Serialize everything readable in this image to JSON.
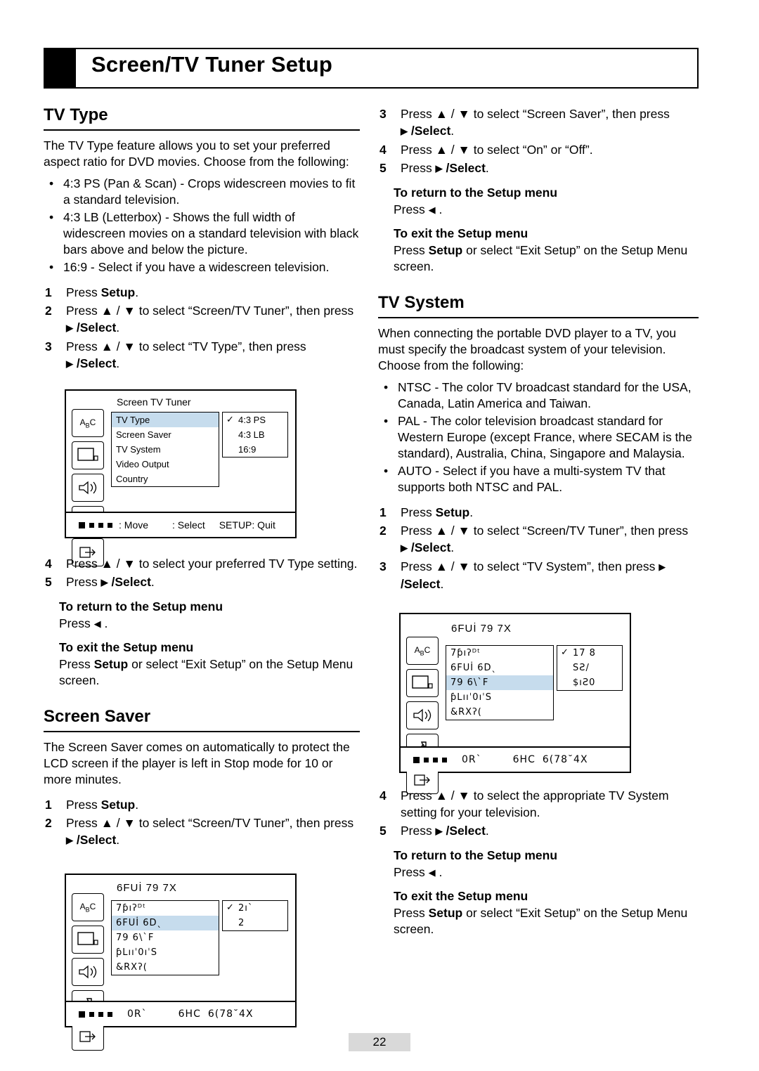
{
  "header": {
    "title": "Screen/TV Tuner Setup"
  },
  "page_number": "22",
  "left": {
    "tv_type": {
      "heading": "TV Type",
      "intro": "The TV Type feature allows you to set your preferred aspect ratio for DVD movies. Choose from the following:",
      "bullets": [
        "4:3 PS (Pan & Scan) - Crops widescreen movies to fit a standard television.",
        "4:3 LB (Letterbox) - Shows the full width of widescreen movies on a standard television with black bars above and below the picture.",
        "16:9 - Select if you have a widescreen television."
      ],
      "steps": [
        {
          "n": "1",
          "text": "Press Setup."
        },
        {
          "n": "2",
          "text": "Press ▲ / ▼ to select “Screen/TV Tuner”, then press ▶ /Select."
        },
        {
          "n": "3",
          "text": "Press ▲ / ▼ to select “TV Type”, then press ▶ /Select."
        }
      ],
      "steps2": [
        {
          "n": "4",
          "text": "Press ▲ / ▼ to select your preferred TV Type setting."
        },
        {
          "n": "5",
          "text": "Press ▶ /Select."
        }
      ],
      "return_head": "To return to the Setup menu",
      "return_body": "Press ◀ .",
      "exit_head": "To exit the Setup menu",
      "exit_body": "Press Setup or select “Exit Setup” on the Setup Menu screen."
    },
    "screen_saver": {
      "heading": "Screen Saver",
      "intro": "The Screen Saver comes on automatically to protect the LCD screen if the player is left in Stop mode for 10 or more minutes.",
      "steps": [
        {
          "n": "1",
          "text": "Press Setup."
        },
        {
          "n": "2",
          "text": "Press ▲ / ▼ to select “Screen/TV Tuner”, then press ▶ /Select."
        }
      ]
    },
    "osd_tvtype": {
      "title": "Screen TV Tuner",
      "menu": [
        "TV Type",
        "Screen Saver",
        "TV System",
        "Video Output",
        "Country"
      ],
      "highlight_index": 0,
      "options": [
        "4:3 PS",
        "4:3 LB",
        "16:9"
      ],
      "checked_index": 0,
      "footer": [
        ": Move",
        ": Select",
        "SETUP: Quit"
      ]
    },
    "osd_screensaver": {
      "title": "6FUİ 79 7X",
      "menu": [
        "7ƥıʔᴰᵗ",
        "6FUİ 6Dˎ",
        "79 6\\ˋF",
        "ƥLııˈ0ıˈS",
        "&RXʔ("
      ],
      "highlight_index": 1,
      "options": [
        "2ıˋ",
        "2"
      ],
      "checked_index": 0,
      "footer": [
        "0Rˋ",
        "6HC",
        "6(78˘4X"
      ]
    }
  },
  "right": {
    "tv_type_cont": {
      "steps": [
        {
          "n": "3",
          "text": "Press ▲ / ▼ to select “Screen Saver”, then press ▶ /Select."
        },
        {
          "n": "4",
          "text": "Press ▲ / ▼ to select “On” or “Off”."
        },
        {
          "n": "5",
          "text": "Press ▶ /Select."
        }
      ],
      "return_head": "To return to the Setup menu",
      "return_body": "Press ◀ .",
      "exit_head": "To exit the Setup menu",
      "exit_body": "Press Setup or select “Exit Setup” on the Setup Menu screen."
    },
    "tv_system": {
      "heading": "TV System",
      "intro": "When connecting the portable DVD player to a TV, you must specify the broadcast system of your television. Choose from the following:",
      "bullets": [
        "NTSC - The color TV broadcast standard for the USA, Canada, Latin America and Taiwan.",
        "PAL - The color television broadcast standard for Western Europe (except France, where SECAM is the standard), Australia, China, Singapore and Malaysia.",
        "AUTO - Select if you have a multi-system TV that supports both NTSC and PAL."
      ],
      "steps": [
        {
          "n": "1",
          "text": "Press Setup."
        },
        {
          "n": "2",
          "text": "Press ▲ / ▼ to select “Screen/TV Tuner”, then press ▶ /Select."
        },
        {
          "n": "3",
          "text": "Press ▲ / ▼ to select “TV System”, then press ▶ /Select."
        }
      ],
      "steps2": [
        {
          "n": "4",
          "text": "Press ▲ / ▼ to select the appropriate TV System setting for your television."
        },
        {
          "n": "5",
          "text": "Press ▶ /Select."
        }
      ],
      "return_head": "To return to the Setup menu",
      "return_body": "Press ◀ .",
      "exit_head": "To exit the Setup menu",
      "exit_body": "Press Setup or select “Exit Setup” on the Setup Menu screen."
    },
    "osd_tvsystem": {
      "title": "6FUİ 79 7X",
      "menu": [
        "7ƥıʔᴰᵗ",
        "6FUİ 6Dˎ",
        "79 6\\ˋF",
        "ƥLııˈ0ıˈS",
        "&RXʔ("
      ],
      "highlight_index": 2,
      "options": [
        "17 8",
        "SƧ/",
        "$ıƧ0"
      ],
      "checked_index": 0,
      "footer": [
        "0Rˋ",
        "6HC",
        "6(78˘4X"
      ]
    }
  }
}
